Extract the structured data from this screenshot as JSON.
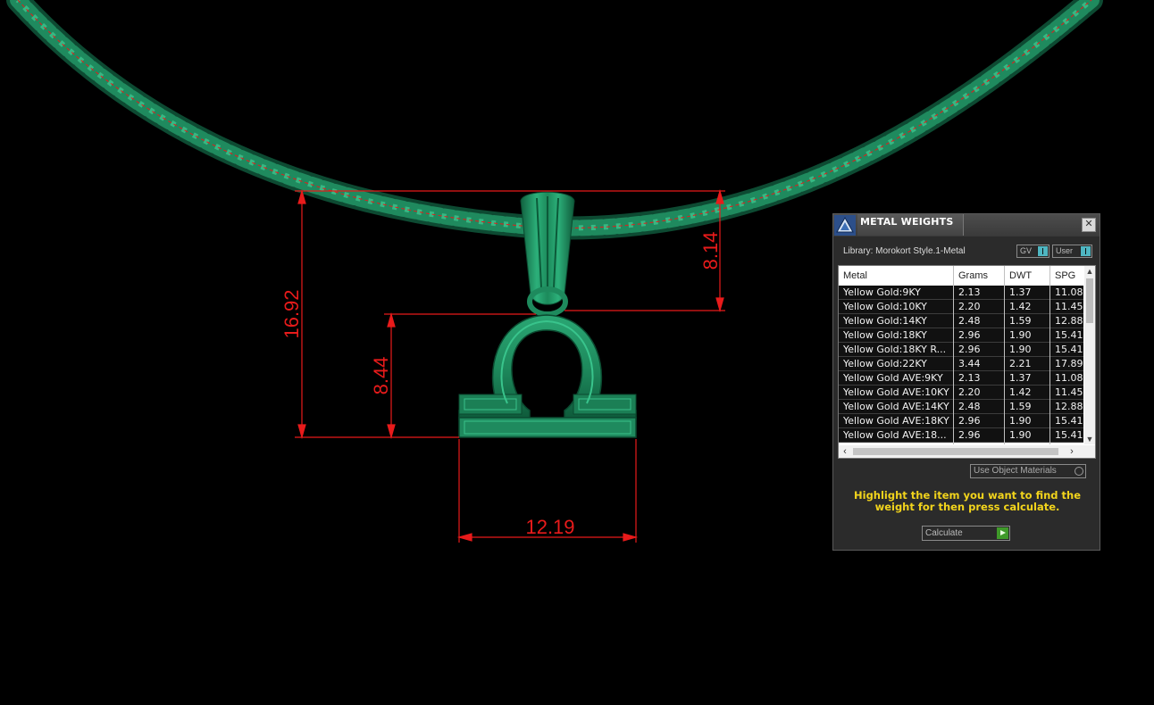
{
  "viewport": {
    "dimensions": {
      "total_height": "16.92",
      "bail_height": "8.14",
      "symbol_height": "8.44",
      "symbol_width": "12.19"
    },
    "colors": {
      "metal": "#1f8a5e",
      "dimension": "#e81b1b",
      "background": "#000000"
    }
  },
  "panel": {
    "title": "METAL WEIGHTS",
    "close_label": "✕",
    "library": "Library: Morokort Style.1-Metal",
    "toggles": [
      "GV",
      "User"
    ],
    "columns": [
      "Metal",
      "Grams",
      "DWT",
      "SPG"
    ],
    "rows": [
      [
        "Yellow Gold:9KY",
        "2.13",
        "1.37",
        "11.08"
      ],
      [
        "Yellow Gold:10KY",
        "2.20",
        "1.42",
        "11.45"
      ],
      [
        "Yellow Gold:14KY",
        "2.48",
        "1.59",
        "12.88"
      ],
      [
        "Yellow Gold:18KY",
        "2.96",
        "1.90",
        "15.41"
      ],
      [
        "Yellow Gold:18KY R...",
        "2.96",
        "1.90",
        "15.41"
      ],
      [
        "Yellow Gold:22KY",
        "3.44",
        "2.21",
        "17.89"
      ],
      [
        "Yellow Gold AVE:9KY",
        "2.13",
        "1.37",
        "11.08"
      ],
      [
        "Yellow Gold AVE:10KY",
        "2.20",
        "1.42",
        "11.45"
      ],
      [
        "Yellow Gold AVE:14KY",
        "2.48",
        "1.59",
        "12.88"
      ],
      [
        "Yellow Gold AVE:18KY",
        "2.96",
        "1.90",
        "15.41"
      ],
      [
        "Yellow Gold AVE:18...",
        "2.96",
        "1.90",
        "15.41"
      ]
    ],
    "use_object_materials": "Use Object Materials",
    "hint": "Highlight the item you want to find the weight for then press calculate.",
    "calculate_label": "Calculate",
    "colors": {
      "hint": "#f2d41c",
      "toggle": "#4fb6c2",
      "go": "#3f9a2a"
    }
  }
}
